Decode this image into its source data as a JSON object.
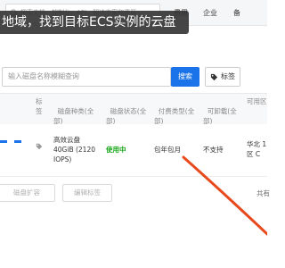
{
  "header": {
    "search_placeholder": "搜索文档、控制台、API、解决方案和资源",
    "nav": [
      "费用",
      "企业",
      "备"
    ]
  },
  "tooltip": "地域，找到目标ECS实例的云盘",
  "filter": {
    "input_placeholder": "输入磁盘名称模糊查询",
    "search_label": "搜索",
    "tag_label": "标签"
  },
  "table": {
    "headers": {
      "tag": "标\n签",
      "disk_type": "磁盘种类(全\n部)",
      "disk_status": "磁盘状态(全\n部)",
      "billing_type": "付费类型(全\n部)",
      "detachable": "可卸载(全\n部)",
      "zone": "可用区"
    },
    "row": {
      "disk_type": "高效云盘\n40GiB (2120\nIOPS)",
      "status": "使用中",
      "billing": "包年包月",
      "detachable": "不支持",
      "zone": "华北 1\n区 C"
    }
  },
  "footer": {
    "expand_label": "磁盘扩容",
    "edit_tags_label": "编辑标签",
    "pager_text": "共有"
  },
  "colors": {
    "primary": "#1a73e8",
    "status_in_use": "#1ba81b",
    "arrow": "#e84a1e"
  }
}
